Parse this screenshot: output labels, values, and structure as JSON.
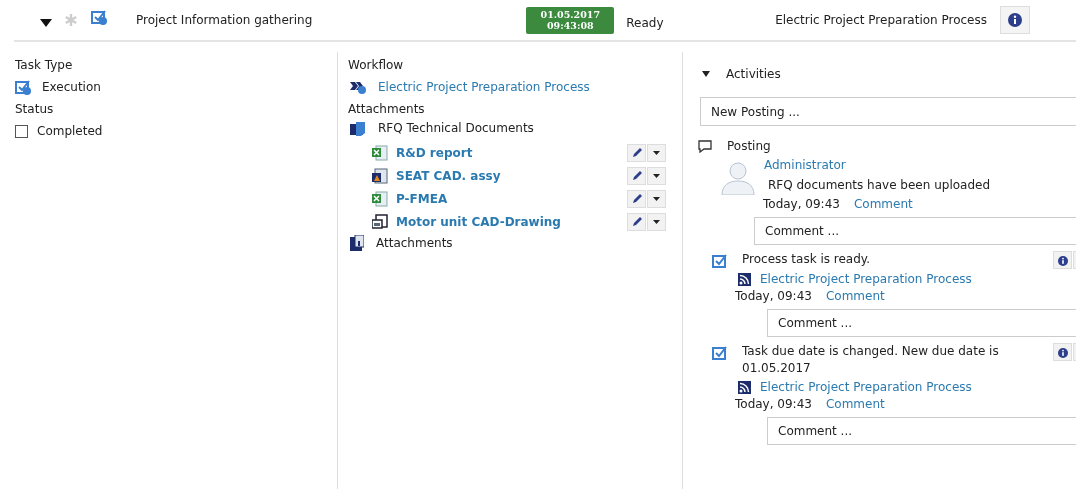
{
  "header": {
    "expanded": true,
    "title": "Project Information gathering",
    "date": "01.05.2017",
    "time": "09:43:08",
    "status": "Ready",
    "process": "Electric Project Preparation Process"
  },
  "details": {
    "task_type_label": "Task Type",
    "task_type": "Execution",
    "status_label": "Status",
    "status_option": {
      "label": "Completed",
      "checked": false
    }
  },
  "workflow": {
    "label": "Workflow",
    "link": "Electric Project Preparation Process"
  },
  "attachments": {
    "label": "Attachments",
    "folder": "RFQ Technical Documents",
    "files": [
      {
        "name": "R&D report",
        "kind": "spreadsheet"
      },
      {
        "name": "SEAT CAD. assy",
        "kind": "cad"
      },
      {
        "name": "P-FMEA",
        "kind": "spreadsheet"
      },
      {
        "name": "Motor unit CAD-Drawing",
        "kind": "drawing"
      }
    ],
    "footer": "Attachments"
  },
  "activities": {
    "title": "Activities",
    "expanded": true,
    "new_posting_placeholder": "New Posting ...",
    "items": [
      {
        "kind": "posting",
        "title": "Posting",
        "author": "Administrator",
        "message": "RFQ documents have been uploaded",
        "time": "Today, 09:43",
        "comment_link": "Comment",
        "comment_placeholder": "Comment ..."
      },
      {
        "kind": "task",
        "title": "Process task is ready.",
        "process": "Electric Project Preparation Process",
        "time": "Today, 09:43",
        "comment_link": "Comment",
        "comment_placeholder": "Comment ..."
      },
      {
        "kind": "task",
        "title": "Task due date is changed. New due date is 01.05.2017",
        "process": "Electric Project Preparation Process",
        "time": "Today, 09:43",
        "comment_link": "Comment",
        "comment_placeholder": "Comment ..."
      }
    ]
  }
}
